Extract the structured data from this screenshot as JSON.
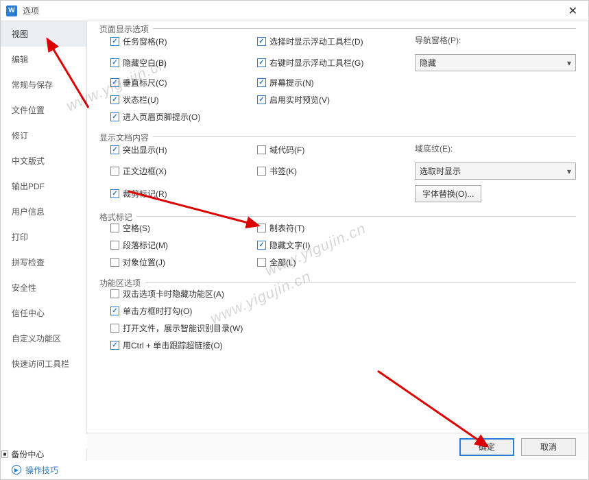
{
  "titlebar": {
    "logo": "W",
    "title": "选项"
  },
  "sidebar": {
    "items": [
      "视图",
      "编辑",
      "常规与保存",
      "文件位置",
      "修订",
      "中文版式",
      "输出PDF",
      "用户信息",
      "打印",
      "拼写检查",
      "安全性",
      "信任中心",
      "自定义功能区",
      "快速访问工具栏"
    ],
    "backup": "备份中心"
  },
  "groups": {
    "page_display": {
      "title": "页面显示选项",
      "items1": [
        {
          "label": "任务窗格(R)",
          "checked": true
        },
        {
          "label": "隐藏空白(B)",
          "checked": true
        },
        {
          "label": "垂直标尺(C)",
          "checked": true
        },
        {
          "label": "状态栏(U)",
          "checked": true
        },
        {
          "label": "进入页眉页脚提示(O)",
          "checked": true
        }
      ],
      "items2": [
        {
          "label": "选择时显示浮动工具栏(D)",
          "checked": true
        },
        {
          "label": "右键时显示浮动工具栏(G)",
          "checked": true
        },
        {
          "label": "屏幕提示(N)",
          "checked": true
        },
        {
          "label": "启用实时预览(V)",
          "checked": true
        }
      ],
      "nav_label": "导航窗格(P):",
      "nav_value": "隐藏"
    },
    "doc_content": {
      "title": "显示文档内容",
      "items1": [
        {
          "label": "突出显示(H)",
          "checked": true
        },
        {
          "label": "正文边框(X)",
          "checked": false
        },
        {
          "label": "裁剪标记(R)",
          "checked": true
        }
      ],
      "items2": [
        {
          "label": "域代码(F)",
          "checked": false
        },
        {
          "label": "书签(K)",
          "checked": false
        }
      ],
      "shade_label": "域底纹(E):",
      "shade_value": "选取时显示",
      "font_sub": "字体替换(O)..."
    },
    "format_marks": {
      "title": "格式标记",
      "items1": [
        {
          "label": "空格(S)",
          "checked": false
        },
        {
          "label": "段落标记(M)",
          "checked": false
        },
        {
          "label": "对象位置(J)",
          "checked": false
        }
      ],
      "items2": [
        {
          "label": "制表符(T)",
          "checked": false
        },
        {
          "label": "隐藏文字(I)",
          "checked": true
        },
        {
          "label": "全部(L)",
          "checked": false
        }
      ]
    },
    "ribbon": {
      "title": "功能区选项",
      "items": [
        {
          "label": "双击选项卡时隐藏功能区(A)",
          "checked": false
        },
        {
          "label": "单击方框时打勾(O)",
          "checked": true
        },
        {
          "label": "打开文件，展示智能识别目录(W)",
          "checked": false
        },
        {
          "label": "用Ctrl + 单击跟踪超链接(O)",
          "checked": true
        }
      ]
    }
  },
  "footer": {
    "ok": "确定",
    "cancel": "取消"
  },
  "bottomlink": "操作技巧",
  "watermark": "www.yigujin.cn"
}
